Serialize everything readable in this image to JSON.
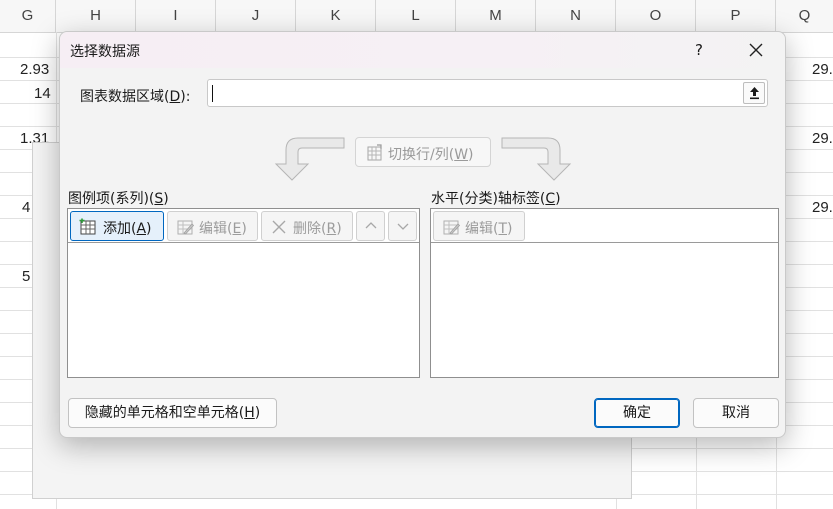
{
  "sheet": {
    "columns": [
      "G",
      "H",
      "I",
      "J",
      "K",
      "L",
      "M",
      "N",
      "O",
      "P",
      "Q"
    ],
    "cells": [
      {
        "id": "g1",
        "text": "2.93"
      },
      {
        "id": "g2",
        "text": "14"
      },
      {
        "id": "g3",
        "text": "1.31"
      },
      {
        "id": "g4",
        "text": "4"
      },
      {
        "id": "g5",
        "text": "5"
      },
      {
        "id": "q1",
        "text": "29."
      },
      {
        "id": "q2",
        "text": "29."
      },
      {
        "id": "q3",
        "text": "29."
      }
    ]
  },
  "dialog": {
    "title": "选择数据源",
    "help_label": "?",
    "close_icon": "close-icon",
    "range": {
      "label_pre": "图表数据区域(",
      "label_key": "D",
      "label_post": "):",
      "value": "",
      "collapse_icon": "collapse-dialog-icon"
    },
    "switch": {
      "label_pre": "切换行/列(",
      "label_key": "W",
      "label_post": ")",
      "enabled": false
    },
    "legend": {
      "label_pre": "图例项(系列)(",
      "label_key": "S",
      "label_post": ")",
      "add_pre": "添加(",
      "add_key": "A",
      "add_post": ")",
      "edit_pre": "编辑(",
      "edit_key": "E",
      "edit_post": ")",
      "delete_pre": "删除(",
      "delete_key": "R",
      "delete_post": ")",
      "items": []
    },
    "axis": {
      "label_pre": "水平(分类)轴标签(",
      "label_key": "C",
      "label_post": ")",
      "edit_pre": "编辑(",
      "edit_key": "T",
      "edit_post": ")",
      "items": []
    },
    "hidden_cells": {
      "pre": "隐藏的单元格和空单元格(",
      "key": "H",
      "post": ")"
    },
    "ok_label": "确定",
    "cancel_label": "取消",
    "colors": {
      "accent": "#0067c0",
      "disabled_text": "#9c9c9c"
    }
  }
}
